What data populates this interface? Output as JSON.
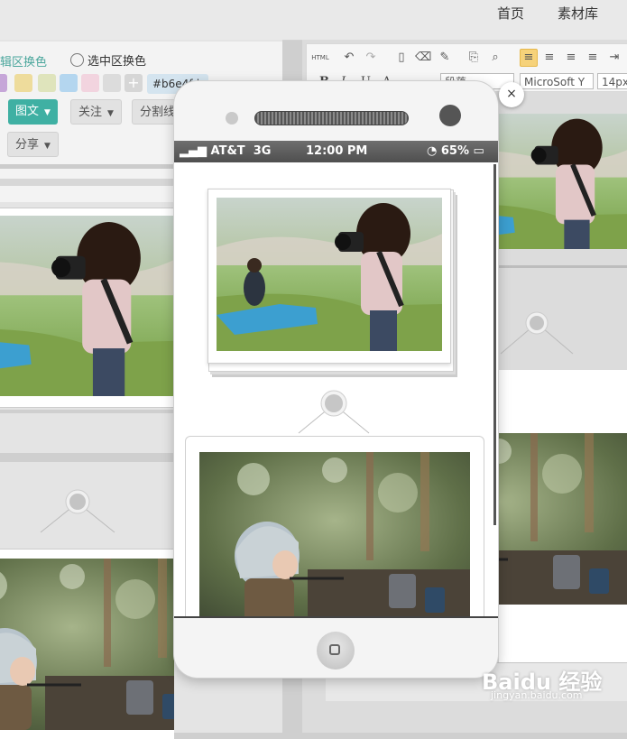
{
  "topnav": {
    "home": "首页",
    "materials": "素材库"
  },
  "left": {
    "edit_color_label": "辑区换色",
    "select_color_label": "选中区换色",
    "swatches": [
      "#c6a6d8",
      "#eedc9c",
      "#dfe4bc",
      "#b4d6ef",
      "#f2d4df",
      "#dcdcdc"
    ],
    "plus": "+",
    "hex_value": "#b6e4fd",
    "tabs": [
      {
        "label": "图文"
      },
      {
        "label": "关注"
      },
      {
        "label": "分割线"
      }
    ],
    "share_label": "分享"
  },
  "right": {
    "html_label": "HTML",
    "paragraph_label": "段落",
    "font_label": "MicroSoft Y",
    "size_label": "14px",
    "bold": "B",
    "italic": "I",
    "underline": "U",
    "fontcolor": "A"
  },
  "phone": {
    "carrier": "AT&T",
    "network": "3G",
    "time": "12:00 PM",
    "battery": "65%"
  },
  "close_label": "×",
  "watermark": {
    "main": "Baidu 经验",
    "sub": "jingyan.baidu.com"
  }
}
